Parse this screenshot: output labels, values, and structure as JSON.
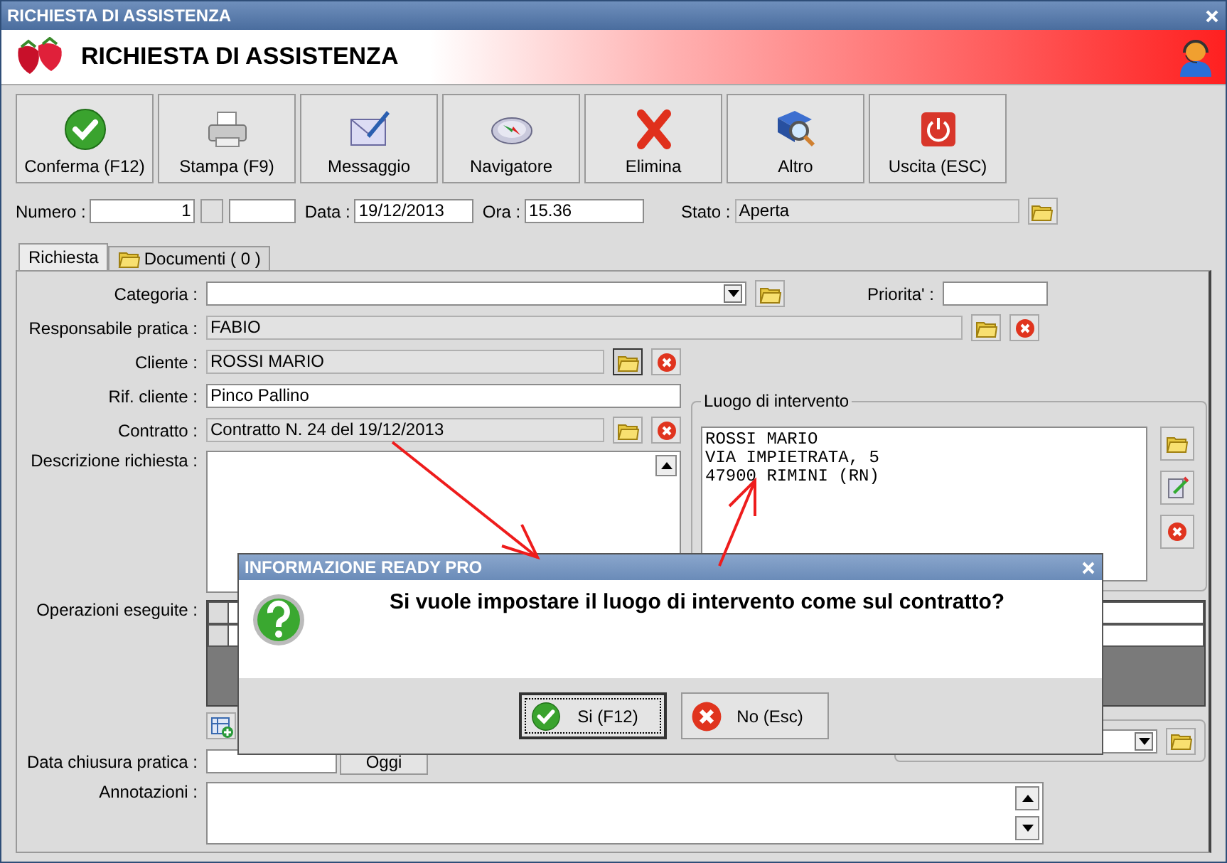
{
  "window": {
    "title": "RICHIESTA DI ASSISTENZA"
  },
  "header": {
    "title": "RICHIESTA DI ASSISTENZA"
  },
  "toolbar": [
    {
      "label": "Conferma (F12)",
      "kind": "confirm"
    },
    {
      "label": "Stampa (F9)",
      "kind": "print"
    },
    {
      "label": "Messaggio",
      "kind": "message"
    },
    {
      "label": "Navigatore",
      "kind": "navigator"
    },
    {
      "label": "Elimina",
      "kind": "delete"
    },
    {
      "label": "Altro",
      "kind": "more"
    },
    {
      "label": "Uscita (ESC)",
      "kind": "exit"
    }
  ],
  "top_fields": {
    "numero": {
      "label": "Numero :",
      "value": "1"
    },
    "data": {
      "label": "Data :",
      "value": "19/12/2013"
    },
    "ora": {
      "label": "Ora :",
      "value": "15.36"
    },
    "stato": {
      "label": "Stato :",
      "value": "Aperta",
      "readonly": true
    }
  },
  "tabs": [
    {
      "label": "Richiesta",
      "selected": true
    },
    {
      "label": "Documenti ( 0 )",
      "selected": false
    }
  ],
  "form": {
    "categoria": {
      "label": "Categoria :"
    },
    "priorita": {
      "label": "Priorita' :"
    },
    "responsabile": {
      "label": "Responsabile pratica :",
      "value": "FABIO",
      "readonly": true
    },
    "cliente": {
      "label": "Cliente :",
      "value": "ROSSI MARIO",
      "readonly": true
    },
    "rif_cliente": {
      "label": "Rif. cliente :",
      "value": "Pinco Pallino",
      "readonly": false
    },
    "contratto": {
      "label": "Contratto :",
      "value": "Contratto N. 24 del 19/12/2013",
      "readonly": true
    },
    "descrizione": {
      "label": "Descrizione richiesta :"
    },
    "luogo": {
      "title": "Luogo di intervento",
      "lines": [
        "ROSSI MARIO",
        "VIA IMPIETRATA, 5",
        "47900 RIMINI (RN)"
      ]
    },
    "operazioni": {
      "label": "Operazioni eseguite :"
    },
    "data_chiusura": {
      "label": "Data chiusura pratica :",
      "button": "Oggi"
    },
    "annotazioni": {
      "label": "Annotazioni :"
    }
  },
  "dialog": {
    "title": "INFORMAZIONE READY PRO",
    "message": "Si vuole impostare il luogo di intervento come sul contratto?",
    "buttons": [
      {
        "label": "Si (F12)",
        "kind": "yes",
        "focused": true
      },
      {
        "label": "No (Esc)",
        "kind": "no",
        "focused": false
      }
    ]
  }
}
